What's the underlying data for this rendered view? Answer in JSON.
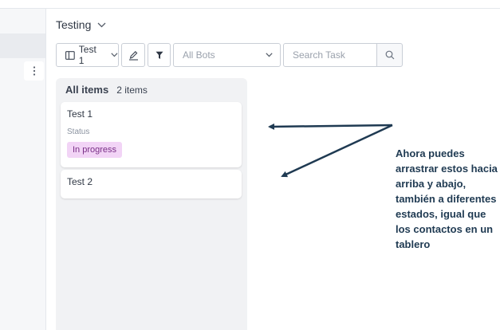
{
  "view": {
    "title": "Testing"
  },
  "toolbar": {
    "view_label": "Test 1",
    "bots_placeholder": "All Bots",
    "search_placeholder": "Search Task"
  },
  "column": {
    "title": "All items",
    "count": "2 items"
  },
  "cards": [
    {
      "title": "Test 1",
      "field_label": "Status",
      "status": "In progress"
    },
    {
      "title": "Test 2"
    }
  ],
  "annotation": {
    "text": "Ahora puedes arrastrar estos hacia arriba y abajo, también a diferentes estados, igual que los contactos en un tablero"
  },
  "colors": {
    "status_badge_bg": "#f2d4f6",
    "status_badge_text": "#7a2f87",
    "annotation_arrow": "#1f3a52"
  },
  "icons": {
    "kebab": "kebab-vertical-icon",
    "view_toggle": "columns-icon",
    "edit": "pencil-icon",
    "filter": "funnel-icon",
    "search": "search-icon",
    "chevron": "chevron-down-icon"
  }
}
